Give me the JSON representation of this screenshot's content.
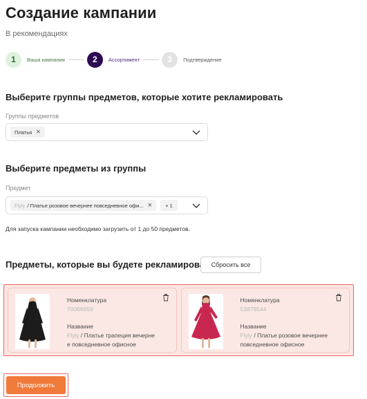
{
  "header": {
    "title": "Создание кампании",
    "subtitle": "В рекомендациях"
  },
  "stepper": {
    "steps": [
      {
        "number": "1",
        "label": "Ваша кампания",
        "state": "done"
      },
      {
        "number": "2",
        "label": "Ассортимент",
        "state": "active"
      },
      {
        "number": "3",
        "label": "Подтверждение",
        "state": "todo"
      }
    ]
  },
  "groups_section": {
    "heading": "Выберите группы предметов, которые хотите рекламировать",
    "field_label": "Группы предметов",
    "selected_chip": "Платья"
  },
  "items_section": {
    "heading": "Выберите предметы из группы",
    "field_label": "Предмет",
    "chip_brand": "Flyly",
    "chip_text": "/ Платье розовое вечернее повседневное офи...",
    "more_count": "+ 1",
    "hint": "Для запуска кампании необходимо загрузить от 1 до 50 предметов."
  },
  "advertised": {
    "heading": "Предметы, которые вы будете рекламировать",
    "count": "2",
    "reset_label": "Сбросить все",
    "products": [
      {
        "sku_label": "Номенклатура",
        "sku_value": "70066659",
        "name_label": "Название",
        "brand": "Flyly",
        "name_line1": "/ Платье трапеция вечерне",
        "name_line2": "е повседневное офисное",
        "dress_color": "#1c1c1c"
      },
      {
        "sku_label": "Номенклатура",
        "sku_value": "53879544",
        "name_label": "Название",
        "brand": "Flyly",
        "name_line1": "/ Платье розовое вечернее",
        "name_line2": "повседневное офисное",
        "dress_color": "#c8284f"
      }
    ]
  },
  "footer": {
    "continue_label": "Продолжить"
  },
  "colors": {
    "accent": "#f07a3a",
    "active_step": "#2c0a52",
    "highlight_border": "#ef6464"
  }
}
